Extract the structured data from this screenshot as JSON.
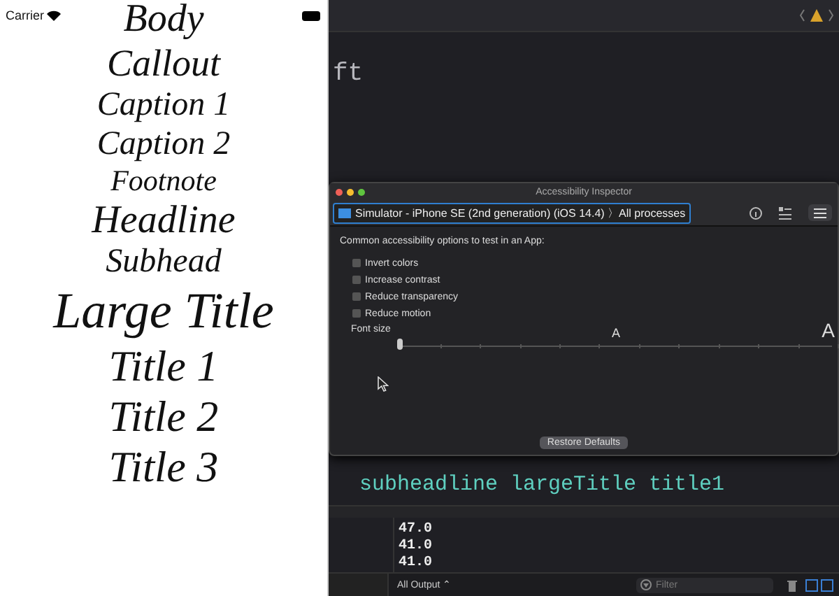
{
  "simulator": {
    "status_bar": {
      "carrier": "Carrier"
    },
    "font_styles": [
      "Body",
      "Callout",
      "Caption 1",
      "Caption 2",
      "Footnote",
      "Headline",
      "Subhead",
      "Large Title",
      "Title 1",
      "Title 2",
      "Title 3"
    ]
  },
  "editor": {
    "code_lines": [
      "ft"
    ],
    "lower_code_lines": [
      "subheadline  largeTitle  title1"
    ]
  },
  "accessibility_inspector": {
    "title": "Accessibility Inspector",
    "target": "Simulator - iPhone SE (2nd generation) (iOS 14.4)",
    "separator": "〉",
    "process": "All processes",
    "heading": "Common accessibility options to test in an App:",
    "options": [
      {
        "label": "Invert colors",
        "checked": false
      },
      {
        "label": "Increase contrast",
        "checked": false
      },
      {
        "label": "Reduce transparency",
        "checked": false
      },
      {
        "label": "Reduce motion",
        "checked": false
      }
    ],
    "font_size": {
      "label": "Font size",
      "level": 0,
      "small_mark": "A",
      "large_mark": "A"
    },
    "restore_button": "Restore Defaults"
  },
  "console": {
    "output_lines": [
      "47.0",
      "41.0",
      "41.0"
    ],
    "filter_menu": "All Output ⌃",
    "filter_placeholder": "Filter"
  }
}
